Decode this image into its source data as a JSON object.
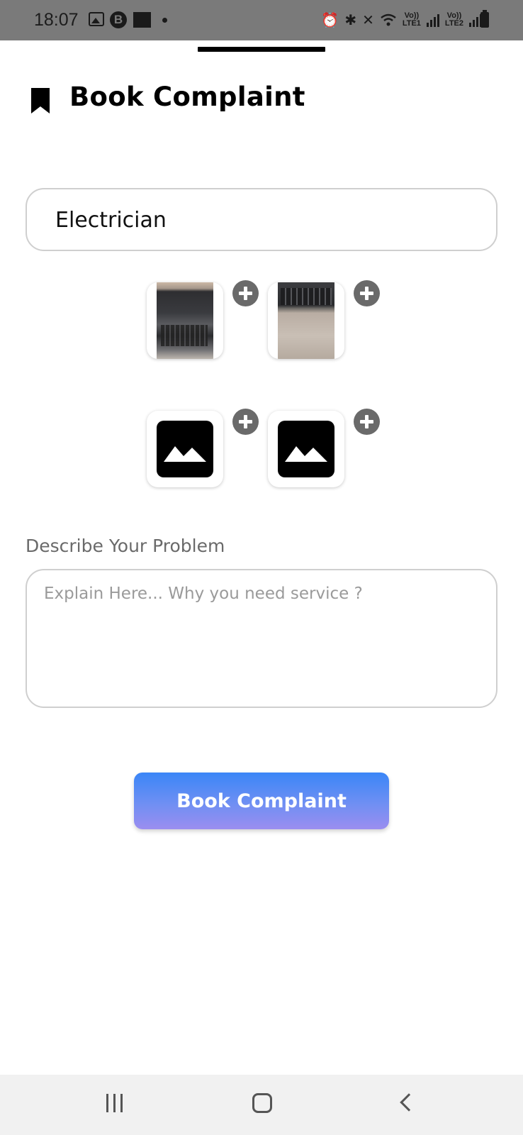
{
  "status_bar": {
    "time": "18:07",
    "sim1": "LTE1",
    "sim2": "LTE2",
    "volte": "Vo))",
    "icons": [
      "gallery-icon",
      "b-app-icon",
      "app-icon",
      "dot-icon",
      "alarm-icon",
      "bluetooth-icon",
      "mute-icon",
      "wifi-icon",
      "signal-icon",
      "battery-icon"
    ]
  },
  "header": {
    "icon": "bookmark-icon",
    "title": "Book Complaint"
  },
  "form": {
    "service_value": "Electrician",
    "images": [
      {
        "type": "photo",
        "subject": "laptop",
        "add_icon": "plus-icon"
      },
      {
        "type": "photo",
        "subject": "keyboard",
        "add_icon": "plus-icon"
      },
      {
        "type": "placeholder",
        "icon": "image-placeholder-icon",
        "add_icon": "plus-icon"
      },
      {
        "type": "placeholder",
        "icon": "image-placeholder-icon",
        "add_icon": "plus-icon"
      }
    ],
    "describe_label": "Describe Your Problem",
    "describe_placeholder": "Explain Here... Why you need service ?",
    "describe_value": ""
  },
  "actions": {
    "submit_label": "Book Complaint"
  },
  "nav_bar": {
    "icons": [
      "recent-apps-icon",
      "home-icon",
      "back-icon"
    ]
  },
  "colors": {
    "status_bar_bg": "#7a7a7a",
    "button_gradient_top": "#3a86f7",
    "button_gradient_bottom": "#9b8ef0",
    "field_border": "#cfcfcf",
    "badge_gray": "#6a6a6a",
    "nav_bar_bg": "#f1f1f1"
  }
}
